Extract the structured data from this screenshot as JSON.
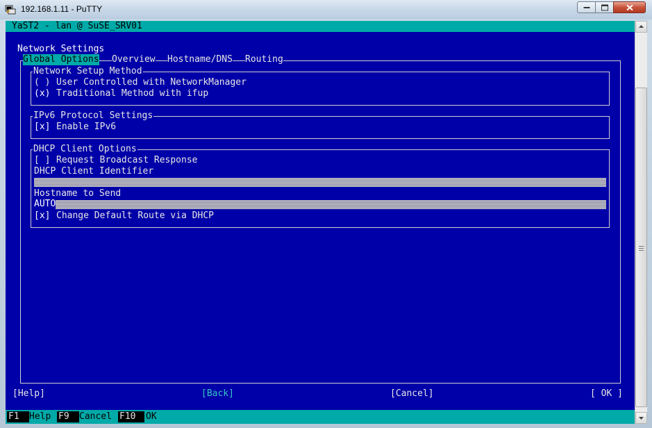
{
  "window": {
    "title": "192.168.1.11 - PuTTY"
  },
  "terminal": {
    "yast_title": "YaST2 - lan @ SuSE_SRV01",
    "section_title": "Network Settings",
    "tabs": [
      "Global Options",
      "Overview",
      "Hostname/DNS",
      "Routing"
    ],
    "setup_method": {
      "legend": "Network Setup Method",
      "opt1_mark": "( )",
      "opt1_label": "User Controlled with NetworkManager",
      "opt2_mark": "(x)",
      "opt2_label": "Traditional Method with ifup"
    },
    "ipv6": {
      "legend": "IPv6 Protocol Settings",
      "mark": "[x]",
      "label": "Enable IPv6"
    },
    "dhcp": {
      "legend": "DHCP Client Options",
      "broadcast_mark": "[ ]",
      "broadcast_label": "Request Broadcast Response",
      "identifier_label": "DHCP Client Identifier",
      "identifier_value": "",
      "hostname_label": "Hostname to Send",
      "hostname_value": "AUTO",
      "route_mark": "[x]",
      "route_label": "Change Default Route via DHCP"
    },
    "buttons": {
      "help": "[Help]",
      "back": "[Back]",
      "cancel": "[Cancel]",
      "ok": "[ OK ]"
    },
    "fkeys": [
      {
        "key": "F1",
        "label": "Help"
      },
      {
        "key": "F9",
        "label": "Cancel"
      },
      {
        "key": "F10",
        "label": "OK"
      }
    ]
  },
  "colors": {
    "terminal_bg": "#0000a8",
    "accent": "#00aaa8"
  }
}
